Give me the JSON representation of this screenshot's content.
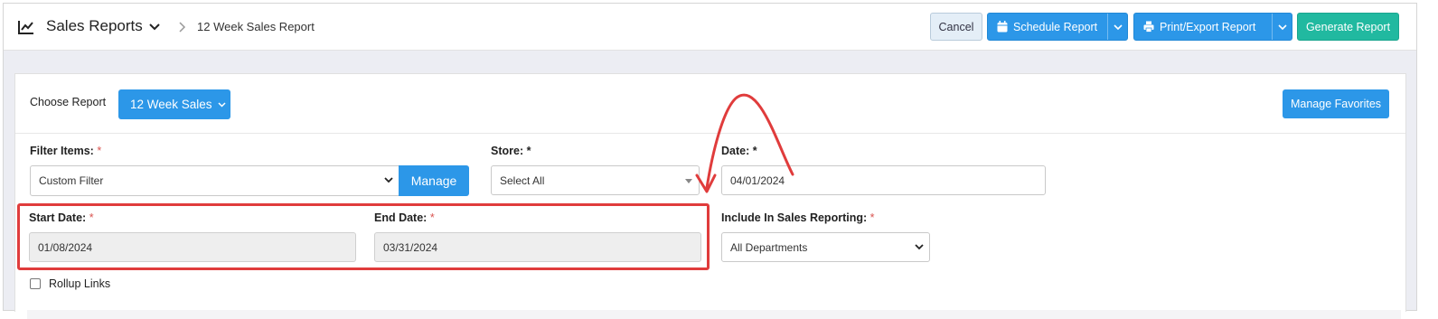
{
  "header": {
    "title": "Sales Reports",
    "breadcrumb": "12 Week Sales Report",
    "buttons": {
      "cancel": "Cancel",
      "schedule": "Schedule Report",
      "print": "Print/Export Report",
      "generate": "Generate Report"
    }
  },
  "report": {
    "choose_label": "Choose Report",
    "choose_value": "12 Week Sales",
    "manage_favorites": "Manage Favorites"
  },
  "filters": {
    "filter_items_label": "Filter Items:",
    "filter_items_value": "Custom Filter",
    "manage_button": "Manage",
    "store_label": "Store: *",
    "store_value": "Select All",
    "date_label": "Date: *",
    "date_value": "04/01/2024",
    "start_date_label": "Start Date:",
    "start_date_value": "01/08/2024",
    "end_date_label": "End Date:",
    "end_date_value": "03/31/2024",
    "include_label": "Include In Sales Reporting:",
    "include_value": "All Departments",
    "required_mark": "*",
    "rollup_label": "Rollup Links"
  },
  "colors": {
    "primary": "#2c97e8",
    "generate": "#21b9a0",
    "annotation": "#e03c3c"
  },
  "icons": {
    "header": "chart-line-icon",
    "schedule": "calendar-icon",
    "print": "printer-icon"
  }
}
